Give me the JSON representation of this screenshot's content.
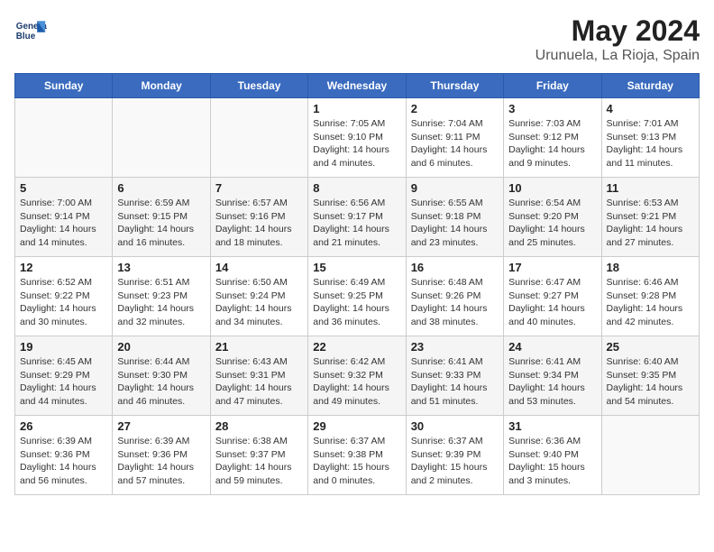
{
  "header": {
    "logo_line1": "General",
    "logo_line2": "Blue",
    "title": "May 2024",
    "subtitle": "Urunuela, La Rioja, Spain"
  },
  "weekdays": [
    "Sunday",
    "Monday",
    "Tuesday",
    "Wednesday",
    "Thursday",
    "Friday",
    "Saturday"
  ],
  "weeks": [
    [
      {
        "day": "",
        "info": ""
      },
      {
        "day": "",
        "info": ""
      },
      {
        "day": "",
        "info": ""
      },
      {
        "day": "1",
        "info": "Sunrise: 7:05 AM\nSunset: 9:10 PM\nDaylight: 14 hours\nand 4 minutes."
      },
      {
        "day": "2",
        "info": "Sunrise: 7:04 AM\nSunset: 9:11 PM\nDaylight: 14 hours\nand 6 minutes."
      },
      {
        "day": "3",
        "info": "Sunrise: 7:03 AM\nSunset: 9:12 PM\nDaylight: 14 hours\nand 9 minutes."
      },
      {
        "day": "4",
        "info": "Sunrise: 7:01 AM\nSunset: 9:13 PM\nDaylight: 14 hours\nand 11 minutes."
      }
    ],
    [
      {
        "day": "5",
        "info": "Sunrise: 7:00 AM\nSunset: 9:14 PM\nDaylight: 14 hours\nand 14 minutes."
      },
      {
        "day": "6",
        "info": "Sunrise: 6:59 AM\nSunset: 9:15 PM\nDaylight: 14 hours\nand 16 minutes."
      },
      {
        "day": "7",
        "info": "Sunrise: 6:57 AM\nSunset: 9:16 PM\nDaylight: 14 hours\nand 18 minutes."
      },
      {
        "day": "8",
        "info": "Sunrise: 6:56 AM\nSunset: 9:17 PM\nDaylight: 14 hours\nand 21 minutes."
      },
      {
        "day": "9",
        "info": "Sunrise: 6:55 AM\nSunset: 9:18 PM\nDaylight: 14 hours\nand 23 minutes."
      },
      {
        "day": "10",
        "info": "Sunrise: 6:54 AM\nSunset: 9:20 PM\nDaylight: 14 hours\nand 25 minutes."
      },
      {
        "day": "11",
        "info": "Sunrise: 6:53 AM\nSunset: 9:21 PM\nDaylight: 14 hours\nand 27 minutes."
      }
    ],
    [
      {
        "day": "12",
        "info": "Sunrise: 6:52 AM\nSunset: 9:22 PM\nDaylight: 14 hours\nand 30 minutes."
      },
      {
        "day": "13",
        "info": "Sunrise: 6:51 AM\nSunset: 9:23 PM\nDaylight: 14 hours\nand 32 minutes."
      },
      {
        "day": "14",
        "info": "Sunrise: 6:50 AM\nSunset: 9:24 PM\nDaylight: 14 hours\nand 34 minutes."
      },
      {
        "day": "15",
        "info": "Sunrise: 6:49 AM\nSunset: 9:25 PM\nDaylight: 14 hours\nand 36 minutes."
      },
      {
        "day": "16",
        "info": "Sunrise: 6:48 AM\nSunset: 9:26 PM\nDaylight: 14 hours\nand 38 minutes."
      },
      {
        "day": "17",
        "info": "Sunrise: 6:47 AM\nSunset: 9:27 PM\nDaylight: 14 hours\nand 40 minutes."
      },
      {
        "day": "18",
        "info": "Sunrise: 6:46 AM\nSunset: 9:28 PM\nDaylight: 14 hours\nand 42 minutes."
      }
    ],
    [
      {
        "day": "19",
        "info": "Sunrise: 6:45 AM\nSunset: 9:29 PM\nDaylight: 14 hours\nand 44 minutes."
      },
      {
        "day": "20",
        "info": "Sunrise: 6:44 AM\nSunset: 9:30 PM\nDaylight: 14 hours\nand 46 minutes."
      },
      {
        "day": "21",
        "info": "Sunrise: 6:43 AM\nSunset: 9:31 PM\nDaylight: 14 hours\nand 47 minutes."
      },
      {
        "day": "22",
        "info": "Sunrise: 6:42 AM\nSunset: 9:32 PM\nDaylight: 14 hours\nand 49 minutes."
      },
      {
        "day": "23",
        "info": "Sunrise: 6:41 AM\nSunset: 9:33 PM\nDaylight: 14 hours\nand 51 minutes."
      },
      {
        "day": "24",
        "info": "Sunrise: 6:41 AM\nSunset: 9:34 PM\nDaylight: 14 hours\nand 53 minutes."
      },
      {
        "day": "25",
        "info": "Sunrise: 6:40 AM\nSunset: 9:35 PM\nDaylight: 14 hours\nand 54 minutes."
      }
    ],
    [
      {
        "day": "26",
        "info": "Sunrise: 6:39 AM\nSunset: 9:36 PM\nDaylight: 14 hours\nand 56 minutes."
      },
      {
        "day": "27",
        "info": "Sunrise: 6:39 AM\nSunset: 9:36 PM\nDaylight: 14 hours\nand 57 minutes."
      },
      {
        "day": "28",
        "info": "Sunrise: 6:38 AM\nSunset: 9:37 PM\nDaylight: 14 hours\nand 59 minutes."
      },
      {
        "day": "29",
        "info": "Sunrise: 6:37 AM\nSunset: 9:38 PM\nDaylight: 15 hours\nand 0 minutes."
      },
      {
        "day": "30",
        "info": "Sunrise: 6:37 AM\nSunset: 9:39 PM\nDaylight: 15 hours\nand 2 minutes."
      },
      {
        "day": "31",
        "info": "Sunrise: 6:36 AM\nSunset: 9:40 PM\nDaylight: 15 hours\nand 3 minutes."
      },
      {
        "day": "",
        "info": ""
      }
    ]
  ]
}
